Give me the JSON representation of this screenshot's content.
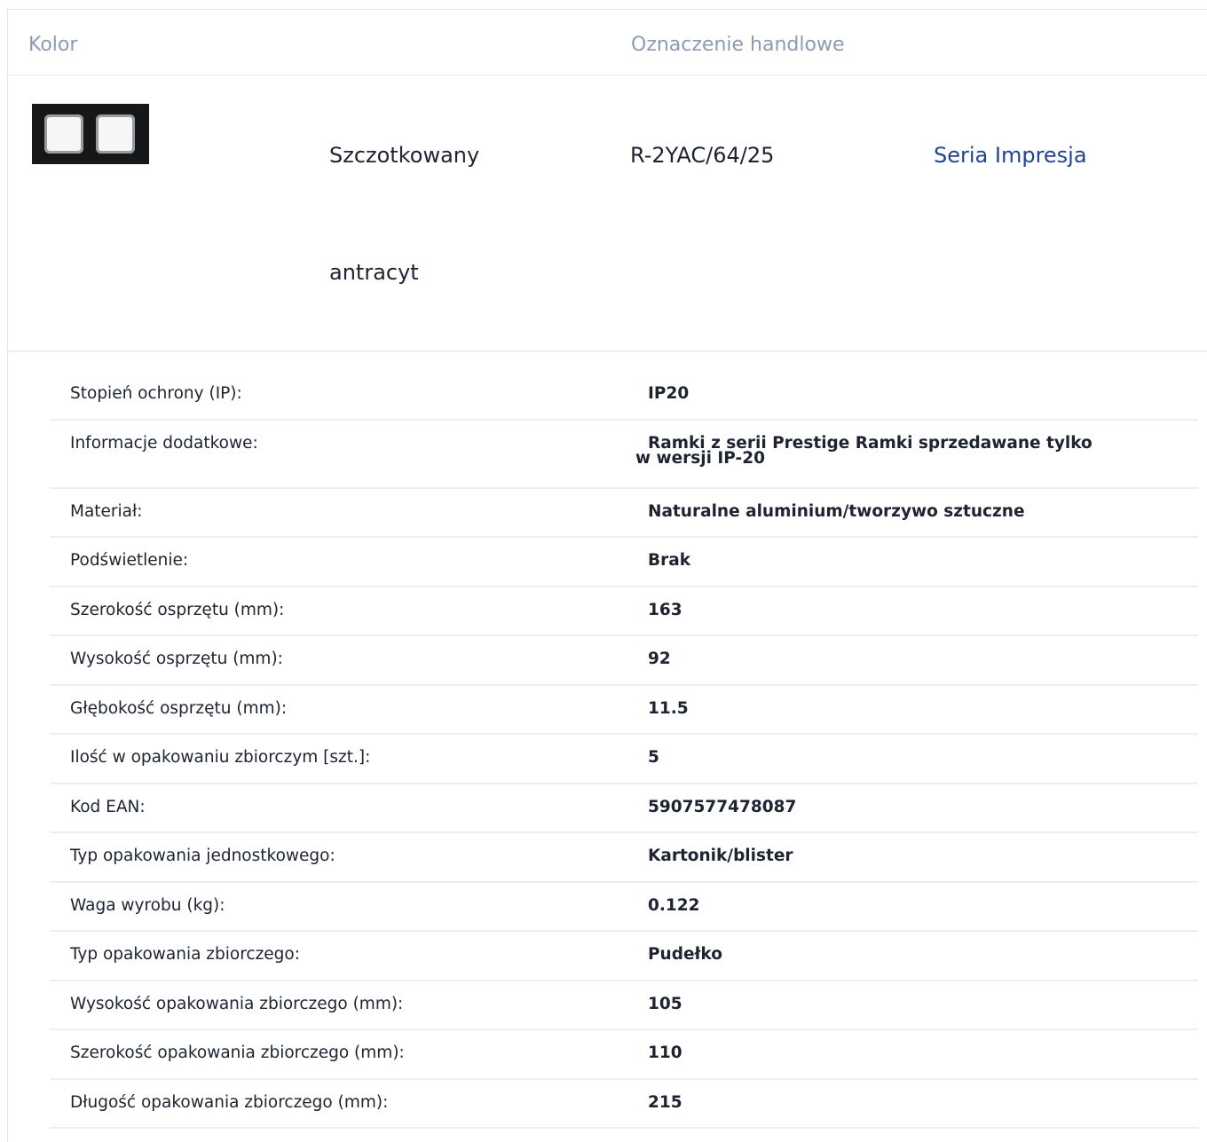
{
  "header": {
    "kolor_label": "Kolor",
    "oznaczenie_label": "Oznaczenie handlowe"
  },
  "product": {
    "thumbnail_icon": "double-frame-icon",
    "color_line1": "Szczotkowany",
    "color_line2": "antracyt",
    "code": "R-2YAC/64/25",
    "series_link": "Seria Impresja"
  },
  "specs": [
    {
      "label": "Stopień ochrony (IP):",
      "value": "IP20"
    },
    {
      "label": "Informacje dodatkowe:",
      "value_line1": "Ramki z serii Prestige Ramki sprzedawane tylko",
      "value_line2": "w wersji IP-20"
    },
    {
      "label": "Materiał:",
      "value": "Naturalne aluminium/tworzywo sztuczne"
    },
    {
      "label": "Podświetlenie:",
      "value": "Brak"
    },
    {
      "label": "Szerokość osprzętu (mm):",
      "value": "163"
    },
    {
      "label": "Wysokość osprzętu (mm):",
      "value": "92"
    },
    {
      "label": "Głębokość osprzętu (mm):",
      "value": "11.5"
    },
    {
      "label": "Ilość w opakowaniu zbiorczym [szt.]:",
      "value": "5"
    },
    {
      "label": "Kod EAN:",
      "value": "5907577478087"
    },
    {
      "label": "Typ opakowania jednostkowego:",
      "value": "Kartonik/blister"
    },
    {
      "label": "Waga wyrobu (kg):",
      "value": "0.122"
    },
    {
      "label": "Typ opakowania zbiorczego:",
      "value": "Pudełko"
    },
    {
      "label": "Wysokość opakowania zbiorczego (mm):",
      "value": "105"
    },
    {
      "label": "Szerokość opakowania zbiorczego (mm):",
      "value": "110"
    },
    {
      "label": "Długość opakowania zbiorczego (mm):",
      "value": "215"
    }
  ]
}
